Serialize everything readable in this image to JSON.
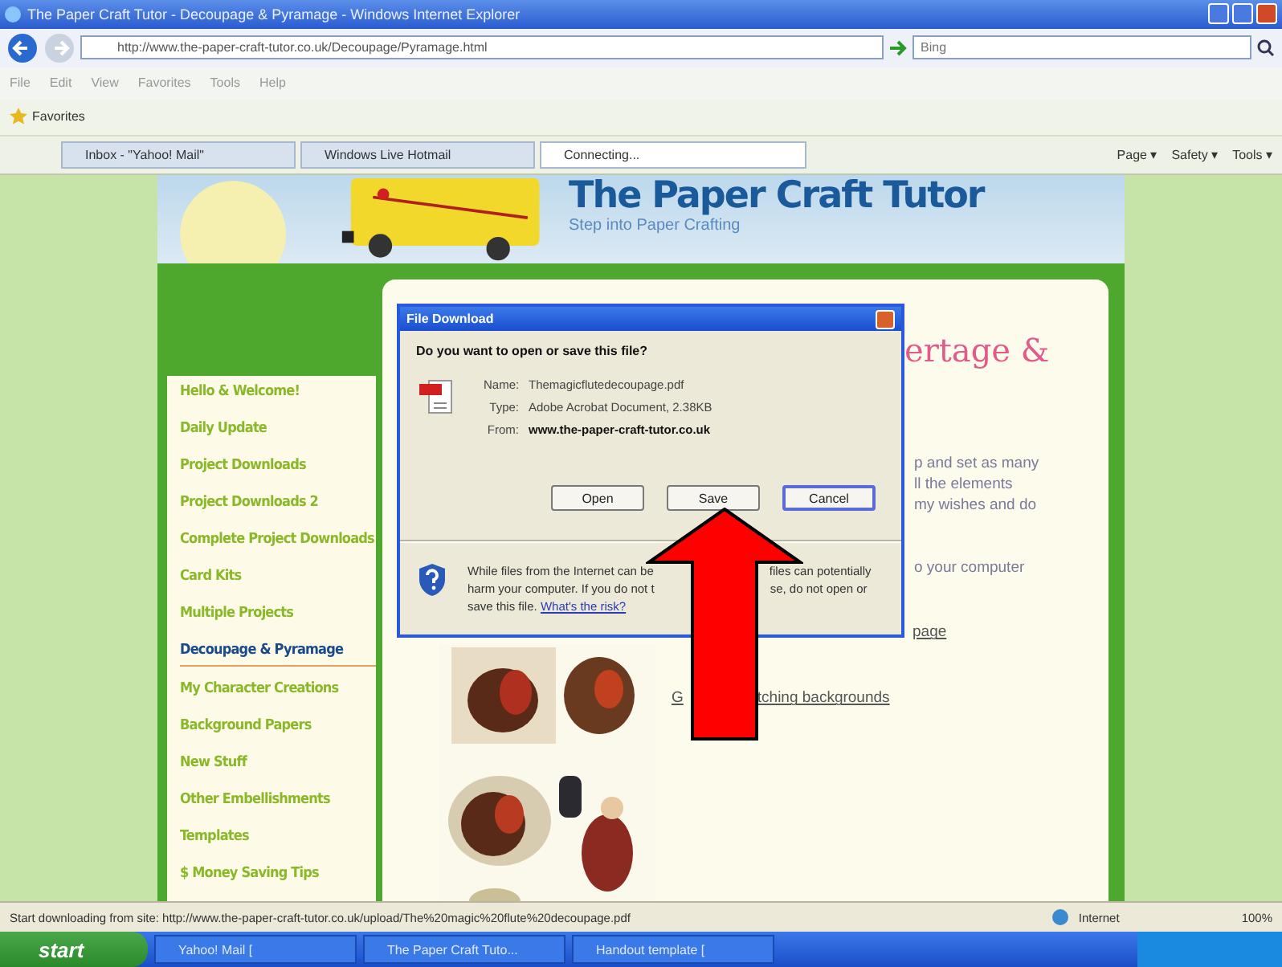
{
  "window": {
    "title": "The Paper Craft Tutor - Decoupage & Pyramage - Windows Internet Explorer"
  },
  "address_bar": {
    "value": "http://www.the-paper-craft-tutor.co.uk/Decoupage/Pyramage.html",
    "search_placeholder": "Bing"
  },
  "menu": [
    "File",
    "Edit",
    "View",
    "Favorites",
    "Tools",
    "Help"
  ],
  "favorites_bar": {
    "label": "Favorites"
  },
  "tabs": [
    {
      "label": "Inbox - \"Yahoo! Mail\"",
      "selected": false
    },
    {
      "label": "Windows Live Hotmail",
      "selected": false
    },
    {
      "label": "Connecting...",
      "selected": true
    }
  ],
  "command_bar": [
    "Page ▾",
    "Safety ▾",
    "Tools ▾"
  ],
  "site": {
    "title": "The Paper Craft Tutor",
    "tagline": "Step into Paper Crafting"
  },
  "sidebar": {
    "items": [
      {
        "label": "Hello & Welcome!",
        "selected": false
      },
      {
        "label": "Daily Update",
        "selected": false
      },
      {
        "label": "Project Downloads",
        "selected": false
      },
      {
        "label": "Project Downloads 2",
        "selected": false
      },
      {
        "label": "Complete Project Downloads",
        "selected": false
      },
      {
        "label": "Card Kits",
        "selected": false
      },
      {
        "label": "Multiple Projects",
        "selected": false
      },
      {
        "label": "Decoupage & Pyramage",
        "selected": true
      },
      {
        "label": "My Character Creations",
        "selected": false
      },
      {
        "label": "Background Papers",
        "selected": false
      },
      {
        "label": "New Stuff",
        "selected": false
      },
      {
        "label": "Other Embellishments",
        "selected": false
      },
      {
        "label": "Templates",
        "selected": false
      },
      {
        "label": "$ Money Saving Tips",
        "selected": false
      }
    ]
  },
  "main": {
    "heading": "ertage &",
    "paragraph_1": [
      "p and set as many",
      "ll the elements",
      "my wishes and do"
    ],
    "paragraph_2": "o your computer",
    "link_1": "page",
    "link_2": {
      "left": "G",
      "right": "tching backgrounds"
    }
  },
  "dialog": {
    "title": "File Download",
    "question": "Do you want to open or save this file?",
    "fields": [
      {
        "label": "Name:",
        "value": "Themagicflutedecoupage.pdf",
        "bold": false
      },
      {
        "label": "Type:",
        "value": "Adobe Acrobat Document, 2.38KB",
        "bold": false
      },
      {
        "label": "From:",
        "value": "www.the-paper-craft-tutor.co.uk",
        "bold": true
      }
    ],
    "buttons": [
      {
        "label": "Open",
        "selected": false
      },
      {
        "label": "Save",
        "selected": false
      },
      {
        "label": "Cancel",
        "selected": true
      }
    ],
    "warning_lines": [
      {
        "left": "While files from the Internet can be",
        "right": "files can potentially"
      },
      {
        "left": "harm your computer. If you do not t",
        "right": "se, do not open or"
      }
    ],
    "warning_last": "save this file.",
    "risk_link": "What's the risk?"
  },
  "status_bar": {
    "text": "Start downloading from site: http://www.the-paper-craft-tutor.co.uk/upload/The%20magic%20flute%20decoupage.pdf",
    "zone": "Internet",
    "zoom": "100%"
  },
  "taskbar": {
    "start": "start",
    "tasks": [
      "Yahoo! Mail [",
      "The Paper Craft Tuto...",
      "Handout template ["
    ]
  }
}
